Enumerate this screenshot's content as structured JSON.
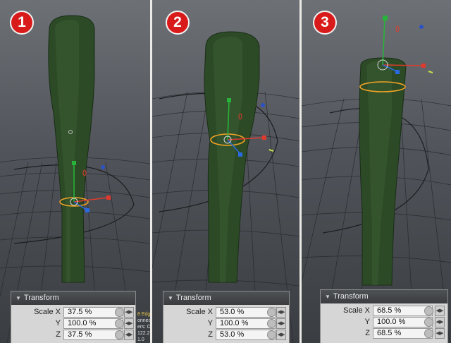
{
  "badges": [
    "1",
    "2",
    "3"
  ],
  "transform_panels": [
    {
      "title": "Transform",
      "rows": [
        {
          "label": "Scale X",
          "value": "37.5 %"
        },
        {
          "label": "Y",
          "value": "100.0 %"
        },
        {
          "label": "Z",
          "value": "37.5 %"
        }
      ]
    },
    {
      "title": "Transform",
      "rows": [
        {
          "label": "Scale X",
          "value": "53.0 %"
        },
        {
          "label": "Y",
          "value": "100.0 %"
        },
        {
          "label": "Z",
          "value": "53.0 %"
        }
      ]
    },
    {
      "title": "Transform",
      "rows": [
        {
          "label": "Scale X",
          "value": "68.5 %"
        },
        {
          "label": "Y",
          "value": "100.0 %"
        },
        {
          "label": "Z",
          "value": "68.5 %"
        }
      ]
    }
  ],
  "side_info": [
    "8 Edg",
    "onnect",
    "ers: Of",
    "122.2",
    "1.0"
  ],
  "colors": {
    "badge_red": "#d91a1a",
    "mesh_green": "#2c4a26",
    "ring_orange": "#f2a324",
    "axis_x": "#e03a2e",
    "axis_y": "#27b33a",
    "axis_z": "#2a6ae0",
    "handle_blue": "#2c52c4"
  },
  "icons": [
    "transform-collapse-icon",
    "reset-dot-icon",
    "stepper-arrows-icon",
    "move-gizmo-icon",
    "falloff-ring-icon"
  ]
}
